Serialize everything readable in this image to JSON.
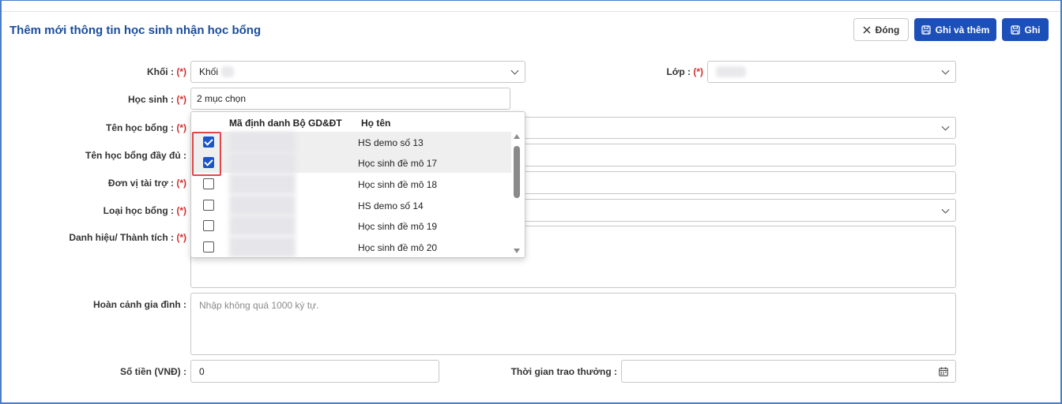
{
  "header": {
    "title": "Thêm mới thông tin học sinh nhận học bổng",
    "close_label": "Đóng",
    "save_add_label": "Ghi và thêm",
    "save_label": "Ghi"
  },
  "required_mark": "(*)",
  "form": {
    "khoi": {
      "label": "Khối :",
      "value": "Khối"
    },
    "lop": {
      "label": "Lớp :",
      "value": ""
    },
    "hoc_sinh": {
      "label": "Học sinh :",
      "value": "2 mục chọn"
    },
    "ten_hoc_bong": {
      "label": "Tên học bổng :"
    },
    "ten_day_du": {
      "label": "Tên học bổng đầy đủ :"
    },
    "don_vi": {
      "label": "Đơn vị tài trợ :"
    },
    "loai": {
      "label": "Loại học bổng :"
    },
    "danh_hieu": {
      "label": "Danh hiệu/ Thành tích :"
    },
    "hoan_canh": {
      "label": "Hoàn cảnh gia đình :",
      "placeholder": "Nhập không quá 1000 ký tự."
    },
    "so_tien": {
      "label": "Số tiền (VNĐ) :",
      "value": "0"
    },
    "thoi_gian": {
      "label": "Thời gian trao thưởng :",
      "value": ""
    }
  },
  "dropdown": {
    "col_code": "Mã định danh Bộ GD&ĐT",
    "col_name": "Họ tên",
    "rows": [
      {
        "name": "HS demo số 13",
        "checked": true
      },
      {
        "name": "Học sinh đề mô 17",
        "checked": true
      },
      {
        "name": "Học sinh đề mô 18",
        "checked": false
      },
      {
        "name": "HS demo số 14",
        "checked": false
      },
      {
        "name": "Học sinh đề mô 19",
        "checked": false
      },
      {
        "name": "Học sinh đề mô 20",
        "checked": false
      }
    ]
  },
  "colors": {
    "accent": "#1c4fb8",
    "title": "#1b4c9c",
    "required": "#d32f2f",
    "highlight": "#e04848"
  }
}
